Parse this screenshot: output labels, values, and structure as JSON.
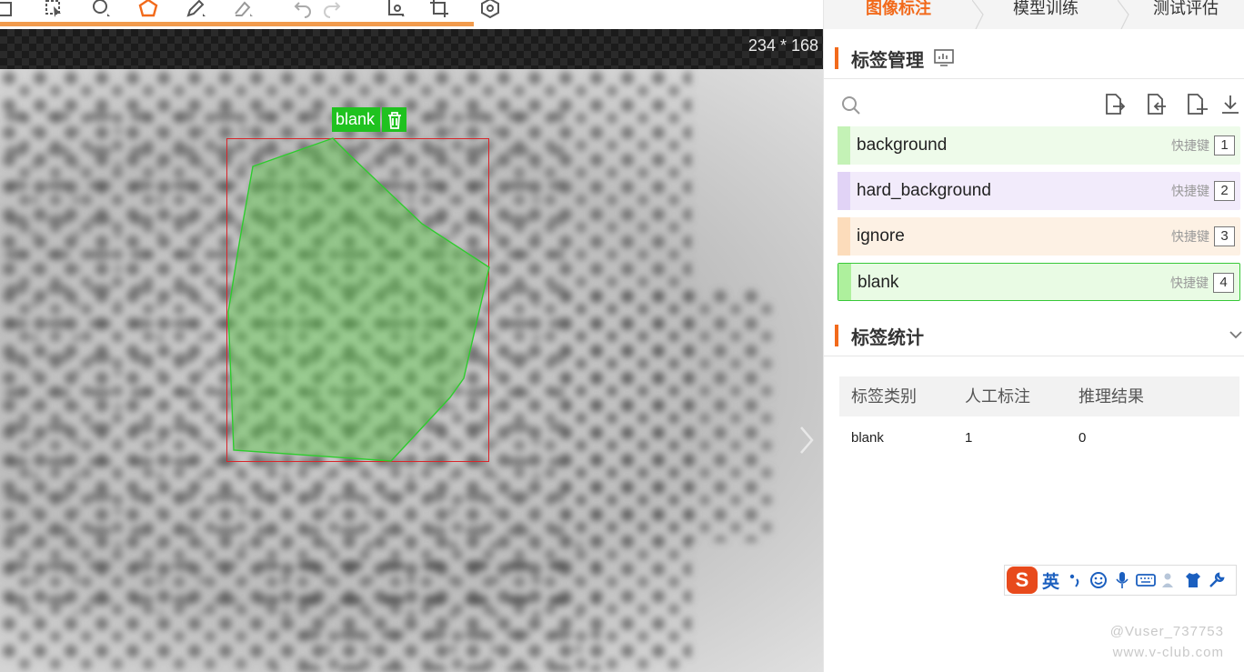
{
  "canvas": {
    "image_dims": "234 * 168",
    "annotation_tag": "blank"
  },
  "tabs": [
    {
      "label": "图像标注"
    },
    {
      "label": "模型训练"
    },
    {
      "label": "测试评估"
    }
  ],
  "label_management": {
    "title": "标签管理",
    "labels": [
      {
        "name": "background",
        "hotkey_text": "快捷键",
        "hotkey": "1",
        "color": "#b6f0a6"
      },
      {
        "name": "hard_background",
        "hotkey_text": "快捷键",
        "hotkey": "2",
        "color": "#d9c7f5"
      },
      {
        "name": "ignore",
        "hotkey_text": "快捷键",
        "hotkey": "3",
        "color": "#fbd9b5"
      },
      {
        "name": "blank",
        "hotkey_text": "快捷键",
        "hotkey": "4",
        "color": "#a9ec98"
      }
    ]
  },
  "label_stats": {
    "title": "标签统计",
    "columns": [
      "标签类别",
      "人工标注",
      "推理结果"
    ],
    "rows": [
      [
        "blank",
        "1",
        "0"
      ]
    ]
  },
  "ime": {
    "logo": "S",
    "mode": "英"
  },
  "watermark": {
    "line1": "@Vuser_737753",
    "line2": "www.v-club.com"
  },
  "colors": {
    "accent": "#f26a1b",
    "annotation": "#1fc21f",
    "bbox": "#d9262b"
  }
}
